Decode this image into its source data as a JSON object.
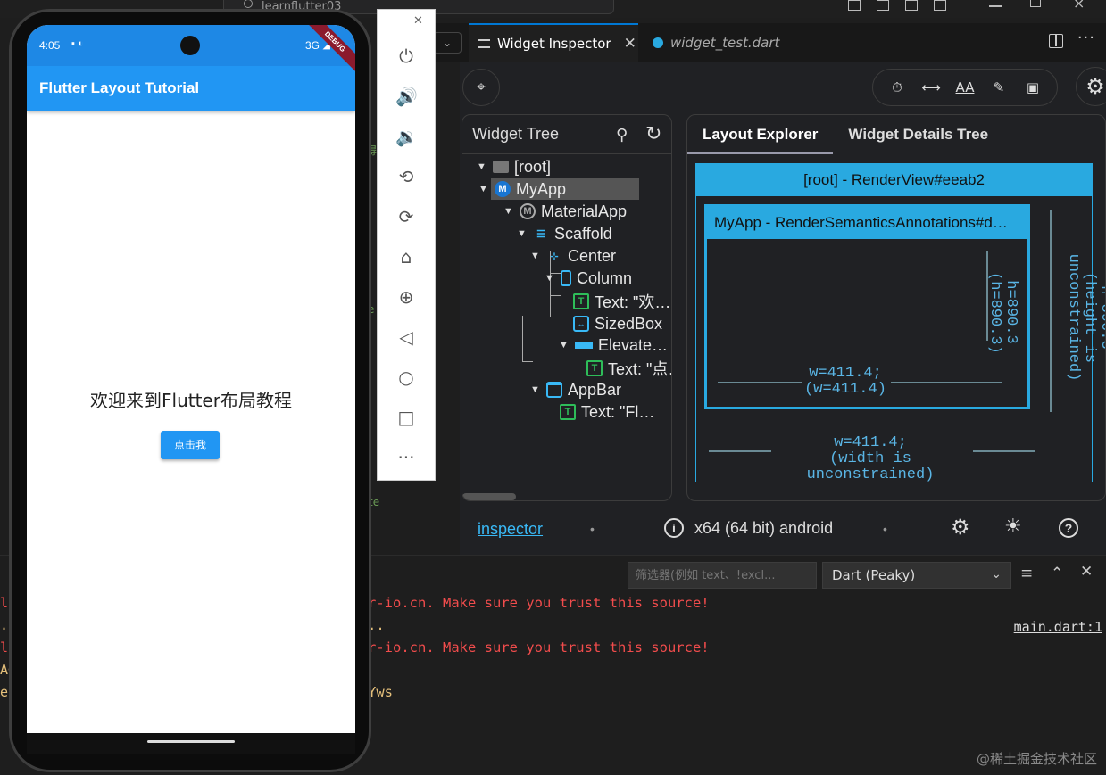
{
  "titlebar": {
    "search_text": "learnflutter03"
  },
  "tabs": {
    "dropdown": "⌄",
    "inspector_label": "Widget Inspector",
    "test_label": "widget_test.dart"
  },
  "devtools": {
    "widget_tree": {
      "title": "Widget Tree",
      "nodes": {
        "root": "[root]",
        "myapp": "MyApp",
        "materialapp": "MaterialApp",
        "scaffold": "Scaffold",
        "center": "Center",
        "column": "Column",
        "text_welcome": "Text: \"欢…",
        "sizedbox": "SizedBox",
        "elevated": "Elevate…",
        "text_click": "Text: \"点…",
        "appbar": "AppBar",
        "text_fl": "Text: \"Fl…"
      }
    },
    "layout_tabs": {
      "layout_explorer": "Layout Explorer",
      "details_tree": "Widget Details Tree"
    },
    "render_view": {
      "title": "[root] - RenderView#eeab2",
      "inner_title": "MyApp - RenderSemanticsAnnotations#d…",
      "inner_height": "h=890.3",
      "inner_height2": "(h=890.3)",
      "inner_width": "w=411.4;",
      "inner_width2": "(w=411.4)",
      "outer_height": "h=890.3",
      "outer_height2": "(height is unconstrained)",
      "outer_width": "w=411.4;",
      "outer_width2": "(width is unconstrained)"
    },
    "status": {
      "inspector_link": "inspector",
      "platform": "x64 (64 bit) android"
    }
  },
  "output": {
    "filter_placeholder": "筛选器(例如 text、!excl...",
    "channel": "Dart (Peaky)",
    "lines": {
      "l1": "r-io.cn. Make sure you trust this source!",
      "l2": "..",
      "l3": "r-io.cn. Make sure you trust this source!",
      "l4": "Yws"
    },
    "link": "main.dart:1"
  },
  "watermark": "@稀土掘金技术社区",
  "phone": {
    "time": "4:05",
    "network": "3G",
    "debug": "DEBUG",
    "appbar_title": "Flutter Layout Tutorial",
    "welcome": "欢迎来到Flutter布局教程",
    "button": "点击我"
  },
  "left_gutter": [
    "程",
    "r",
    "ge",
    "",
    "和",
    "e",
    "",
    "A",
    "r",
    "",
    "xt",
    "{",
    "",
    "d(",
    "ce",
    "ハ",
    "ca",
    "ff",
    "",
    "l",
    ".c",
    "l",
    "AG",
    "er"
  ],
  "colors": {
    "accent": "#2196f3",
    "inspector_blue": "#29a9e0",
    "error_red": "#f14c4c"
  }
}
